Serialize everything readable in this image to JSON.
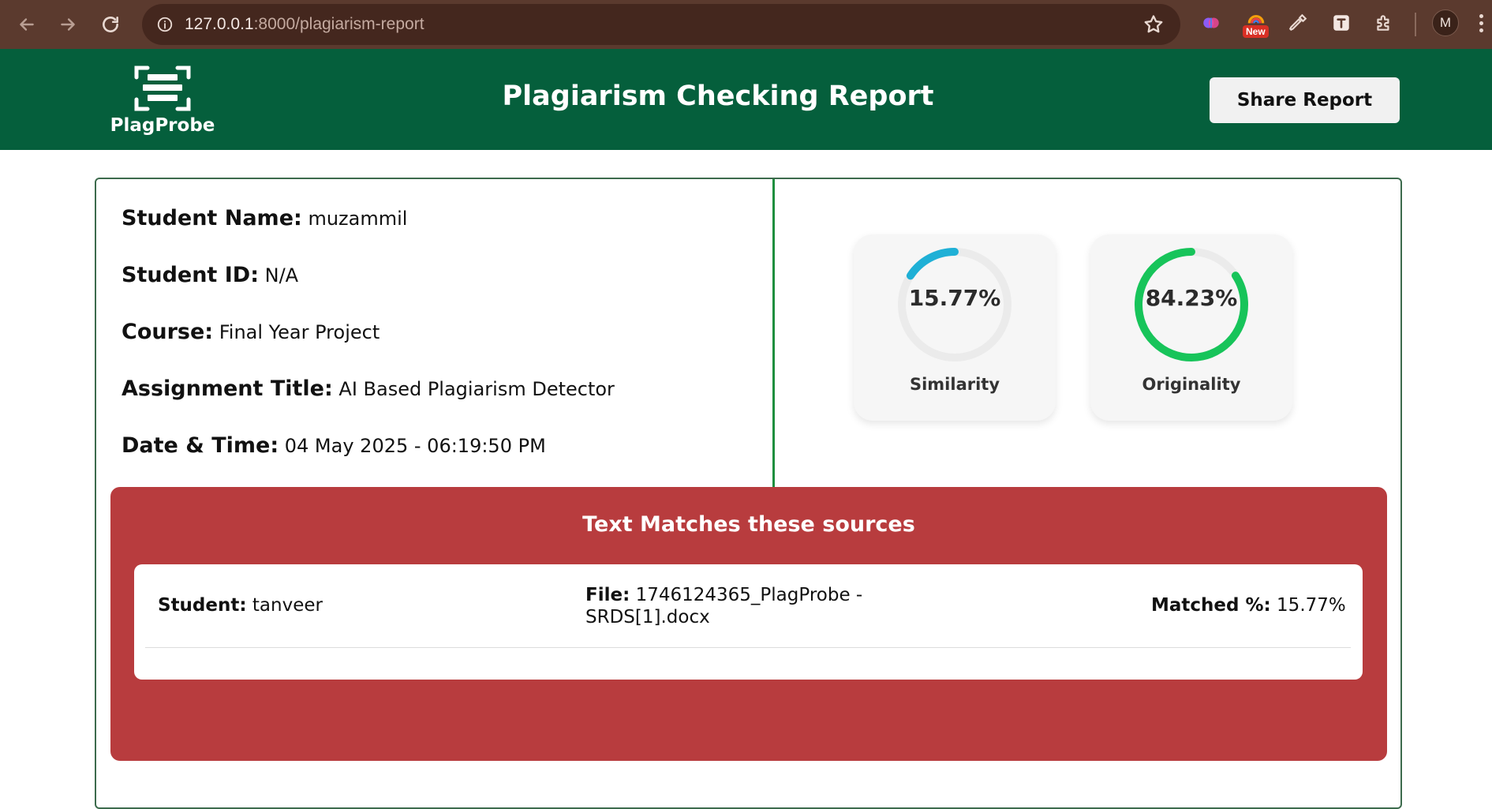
{
  "browser": {
    "url_host": "127.0.0.1",
    "url_path": ":8000/plagiarism-report",
    "new_badge": "New",
    "profile_initial": "M"
  },
  "header": {
    "logo_text": "PlagProbe",
    "title": "Plagiarism Checking Report",
    "share_label": "Share Report",
    "color": "#055f3c"
  },
  "student": {
    "name_label": "Student Name:",
    "name": "muzammil",
    "id_label": "Student ID:",
    "id": "N/A",
    "course_label": "Course:",
    "course": "Final Year Project",
    "assignment_label": "Assignment Title:",
    "assignment": "AI Based Plagiarism Detector",
    "datetime_label": "Date & Time:",
    "datetime": "04 May 2025 - 06:19:50 PM"
  },
  "metrics": {
    "similarity": {
      "value": "15.77%",
      "fraction": 0.1577,
      "label": "Similarity",
      "color": "#1fb0d6"
    },
    "originality": {
      "value": "84.23%",
      "fraction": 0.8423,
      "label": "Originality",
      "color": "#17c45a"
    }
  },
  "matches": {
    "title": "Text Matches these sources",
    "panel_color": "#b83c3e",
    "items": [
      {
        "student_label": "Student:",
        "student": "tanveer",
        "file_label": "File:",
        "file": "1746124365_PlagProbe - SRDS[1].docx",
        "matched_label": "Matched %:",
        "matched": "15.77%"
      }
    ]
  }
}
